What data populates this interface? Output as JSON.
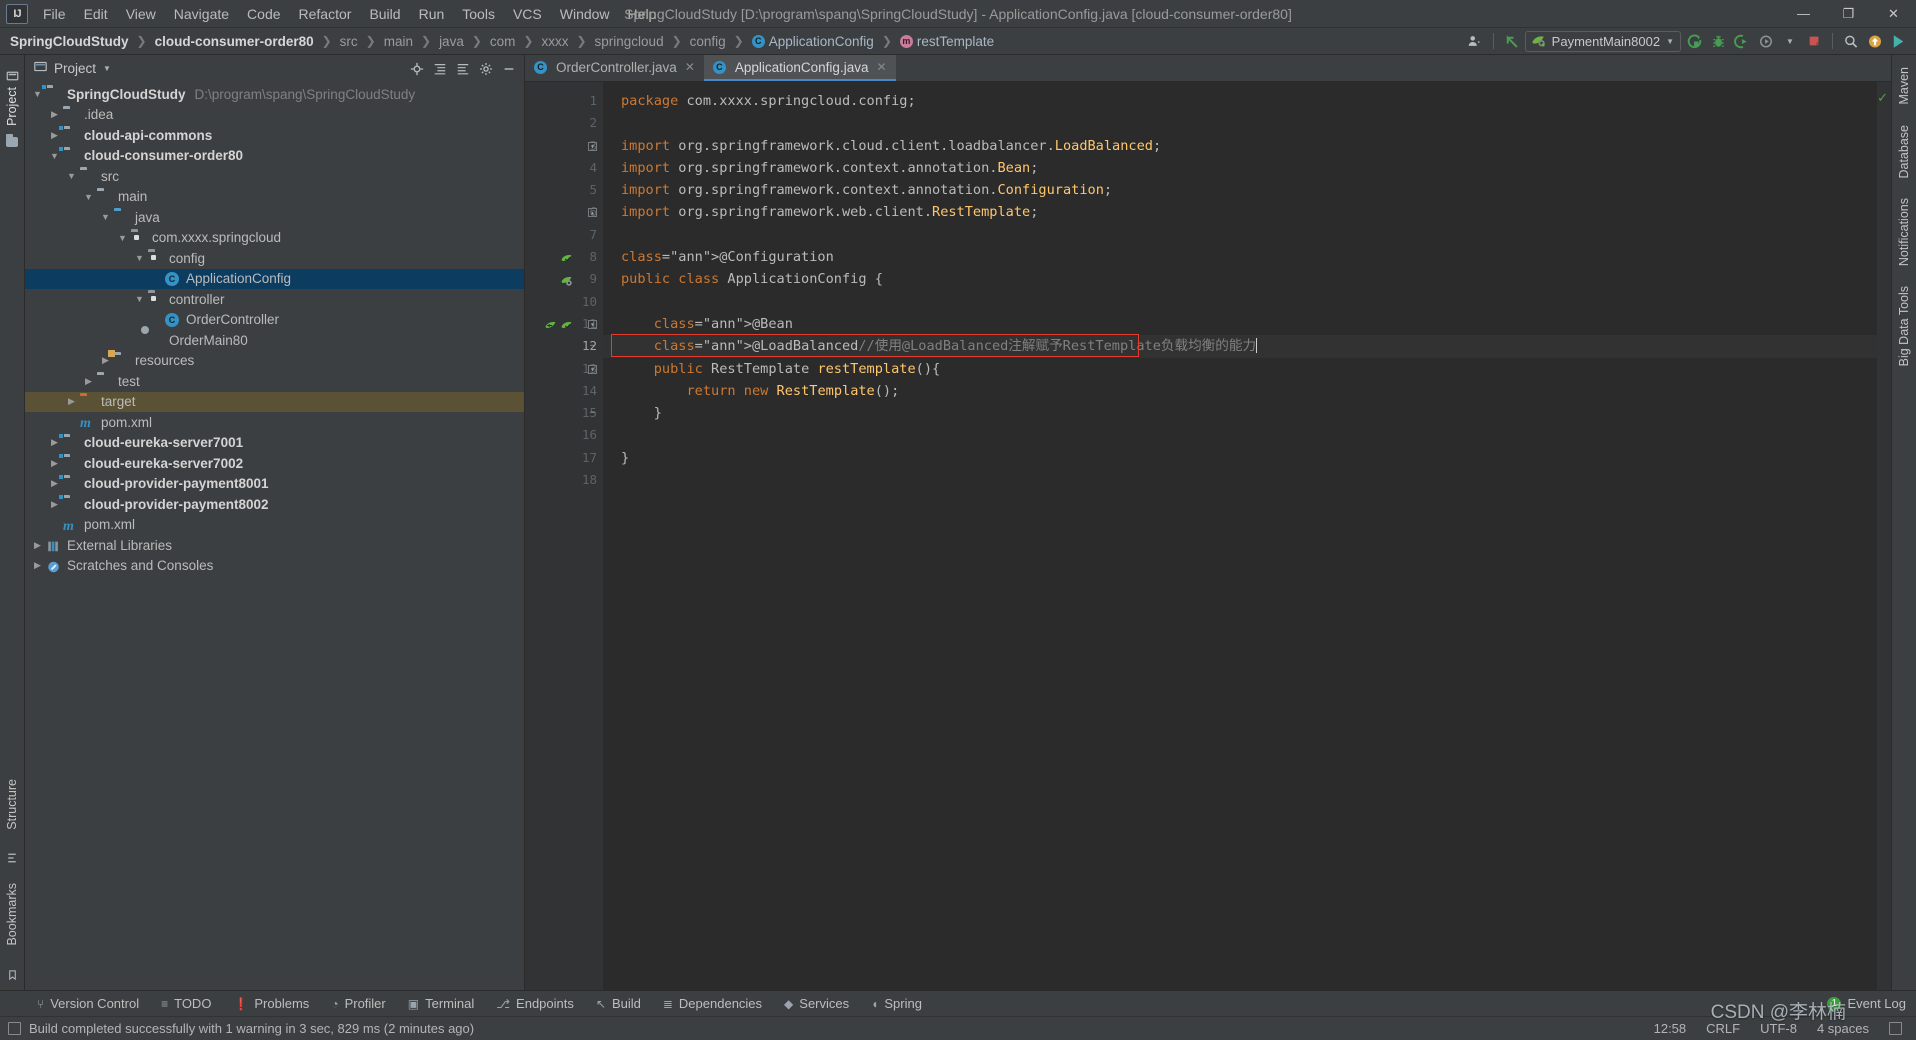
{
  "titlebar": {
    "logo": "IJ",
    "menus": [
      "File",
      "Edit",
      "View",
      "Navigate",
      "Code",
      "Refactor",
      "Build",
      "Run",
      "Tools",
      "VCS",
      "Window",
      "Help"
    ],
    "window_title": "SpringCloudStudy [D:\\program\\spang\\SpringCloudStudy] - ApplicationConfig.java [cloud-consumer-order80]",
    "minimize": "—",
    "maximize": "❐",
    "close": "✕"
  },
  "navbar": {
    "crumbs": [
      {
        "label": "SpringCloudStudy",
        "style": "bold"
      },
      {
        "label": "cloud-consumer-order80",
        "style": "bold"
      },
      {
        "label": "src",
        "style": "dim"
      },
      {
        "label": "main",
        "style": "dim"
      },
      {
        "label": "java",
        "style": "dim"
      },
      {
        "label": "com",
        "style": "dim"
      },
      {
        "label": "xxxx",
        "style": "dim"
      },
      {
        "label": "springcloud",
        "style": "dim"
      },
      {
        "label": "config",
        "style": "dim"
      },
      {
        "label": "ApplicationConfig",
        "style": "cls",
        "icon": "C"
      },
      {
        "label": "restTemplate",
        "style": "mth",
        "icon": "m"
      }
    ],
    "separator": "❯",
    "run_config": "PaymentMain8002",
    "icons": {
      "user": "👤",
      "back_arrow": "↖",
      "run": "▶",
      "debug": "🐞",
      "run_coverage": "▷",
      "profile": "ⓘ",
      "stop": "■",
      "search": "🔍",
      "update": "↑",
      "next": "▶"
    }
  },
  "left_rail": {
    "project_label": "Project",
    "structure_label": "Structure",
    "bookmarks_label": "Bookmarks"
  },
  "right_rail": {
    "items": [
      "Maven",
      "Database",
      "Notifications",
      "Big Data Tools"
    ]
  },
  "project_panel": {
    "title": "Project",
    "tree": [
      {
        "indent": 0,
        "arrow": "down",
        "icon": "module",
        "label": "SpringCloudStudy",
        "bold": true,
        "path": "D:\\program\\spang\\SpringCloudStudy"
      },
      {
        "indent": 1,
        "arrow": "right",
        "icon": "folder",
        "label": ".idea",
        "bold": false,
        "path": ""
      },
      {
        "indent": 1,
        "arrow": "right",
        "icon": "module",
        "label": "cloud-api-commons",
        "bold": true,
        "path": ""
      },
      {
        "indent": 1,
        "arrow": "down",
        "icon": "module",
        "label": "cloud-consumer-order80",
        "bold": true,
        "path": ""
      },
      {
        "indent": 2,
        "arrow": "down",
        "icon": "folder",
        "label": "src",
        "bold": false,
        "path": ""
      },
      {
        "indent": 3,
        "arrow": "down",
        "icon": "folder",
        "label": "main",
        "bold": false,
        "path": ""
      },
      {
        "indent": 4,
        "arrow": "down",
        "icon": "folderblue",
        "label": "java",
        "bold": false,
        "path": ""
      },
      {
        "indent": 5,
        "arrow": "down",
        "icon": "package",
        "label": "com.xxxx.springcloud",
        "bold": false,
        "path": ""
      },
      {
        "indent": 6,
        "arrow": "down",
        "icon": "package",
        "label": "config",
        "bold": false,
        "path": ""
      },
      {
        "indent": 7,
        "arrow": "none",
        "icon": "class",
        "label": "ApplicationConfig",
        "bold": false,
        "path": "",
        "selected": true
      },
      {
        "indent": 6,
        "arrow": "down",
        "icon": "package",
        "label": "controller",
        "bold": false,
        "path": ""
      },
      {
        "indent": 7,
        "arrow": "none",
        "icon": "class",
        "label": "OrderController",
        "bold": false,
        "path": ""
      },
      {
        "indent": 6,
        "arrow": "none",
        "icon": "spring",
        "label": "OrderMain80",
        "bold": false,
        "path": ""
      },
      {
        "indent": 4,
        "arrow": "right",
        "icon": "resources",
        "label": "resources",
        "bold": false,
        "path": ""
      },
      {
        "indent": 3,
        "arrow": "right",
        "icon": "folder",
        "label": "test",
        "bold": false,
        "path": ""
      },
      {
        "indent": 2,
        "arrow": "right",
        "icon": "target",
        "label": "target",
        "bold": false,
        "path": "",
        "selected2": true
      },
      {
        "indent": 2,
        "arrow": "none",
        "icon": "maven",
        "label": "pom.xml",
        "bold": false,
        "path": ""
      },
      {
        "indent": 1,
        "arrow": "right",
        "icon": "module",
        "label": "cloud-eureka-server7001",
        "bold": true,
        "path": ""
      },
      {
        "indent": 1,
        "arrow": "right",
        "icon": "module",
        "label": "cloud-eureka-server7002",
        "bold": true,
        "path": ""
      },
      {
        "indent": 1,
        "arrow": "right",
        "icon": "module",
        "label": "cloud-provider-payment8001",
        "bold": true,
        "path": ""
      },
      {
        "indent": 1,
        "arrow": "right",
        "icon": "module",
        "label": "cloud-provider-payment8002",
        "bold": true,
        "path": ""
      },
      {
        "indent": 1,
        "arrow": "none",
        "icon": "maven",
        "label": "pom.xml",
        "bold": false,
        "path": ""
      },
      {
        "indent": 0,
        "arrow": "right",
        "icon": "library",
        "label": "External Libraries",
        "bold": false,
        "path": ""
      },
      {
        "indent": 0,
        "arrow": "right",
        "icon": "scratch",
        "label": "Scratches and Consoles",
        "bold": false,
        "path": ""
      }
    ]
  },
  "editor": {
    "tabs": [
      {
        "label": "OrderController.java",
        "active": false,
        "icon": "C"
      },
      {
        "label": "ApplicationConfig.java",
        "active": true,
        "icon": "C"
      }
    ],
    "close_glyph": "✕",
    "lines": [
      {
        "n": "1",
        "text": "package com.xxxx.springcloud.config;"
      },
      {
        "n": "2",
        "text": ""
      },
      {
        "n": "3",
        "text": "import org.springframework.cloud.client.loadbalancer.LoadBalanced;"
      },
      {
        "n": "4",
        "text": "import org.springframework.context.annotation.Bean;"
      },
      {
        "n": "5",
        "text": "import org.springframework.context.annotation.Configuration;"
      },
      {
        "n": "6",
        "text": "import org.springframework.web.client.RestTemplate;"
      },
      {
        "n": "7",
        "text": ""
      },
      {
        "n": "8",
        "text": "@Configuration"
      },
      {
        "n": "9",
        "text": "public class ApplicationConfig {"
      },
      {
        "n": "10",
        "text": ""
      },
      {
        "n": "11",
        "text": "    @Bean"
      },
      {
        "n": "12",
        "text": "    @LoadBalanced//使用@LoadBalanced注解赋予RestTemplate负载均衡的能力"
      },
      {
        "n": "13",
        "text": "    public RestTemplate restTemplate(){"
      },
      {
        "n": "14",
        "text": "        return new RestTemplate();"
      },
      {
        "n": "15",
        "text": "    }"
      },
      {
        "n": "16",
        "text": ""
      },
      {
        "n": "17",
        "text": "}"
      },
      {
        "n": "18",
        "text": ""
      }
    ],
    "highlight_line": "12",
    "inspection_ok": "✓"
  },
  "toolwindow_bar": {
    "items": [
      {
        "label": "Version Control",
        "icon": "branch-icon",
        "glyph": "⑂"
      },
      {
        "label": "TODO",
        "icon": "list-icon",
        "glyph": "≡"
      },
      {
        "label": "Problems",
        "icon": "warning-icon",
        "glyph": "❗"
      },
      {
        "label": "Profiler",
        "icon": "gauge-icon",
        "glyph": "◔"
      },
      {
        "label": "Terminal",
        "icon": "terminal-icon",
        "glyph": "▣"
      },
      {
        "label": "Endpoints",
        "icon": "endpoints-icon",
        "glyph": "⎇"
      },
      {
        "label": "Build",
        "icon": "hammer-icon",
        "glyph": "↖"
      },
      {
        "label": "Dependencies",
        "icon": "layers-icon",
        "glyph": "≣"
      },
      {
        "label": "Services",
        "icon": "services-icon",
        "glyph": "◆"
      },
      {
        "label": "Spring",
        "icon": "spring-icon",
        "glyph": "◖"
      }
    ],
    "event_log": "Event Log",
    "event_count": "1"
  },
  "statusbar": {
    "message": "Build completed successfully with 1 warning in 3 sec, 829 ms (2 minutes ago)",
    "time": "12:58",
    "line_separator": "CRLF",
    "encoding": "UTF-8",
    "indent": "4 spaces",
    "lock_glyph": "⬚"
  },
  "watermark": "CSDN @李林楠",
  "colors": {
    "bg": "#3c3f41",
    "editor_bg": "#2b2b2b",
    "gutter_bg": "#313335",
    "selection": "#0d3c61",
    "target_highlight": "#5b5235",
    "accent_blue": "#4a88c7",
    "annotation": "#bbb529",
    "keyword": "#cc7832",
    "method": "#ffc66d",
    "comment": "#808080",
    "error_box": "#e33b2e",
    "spring_green": "#6db33f"
  }
}
